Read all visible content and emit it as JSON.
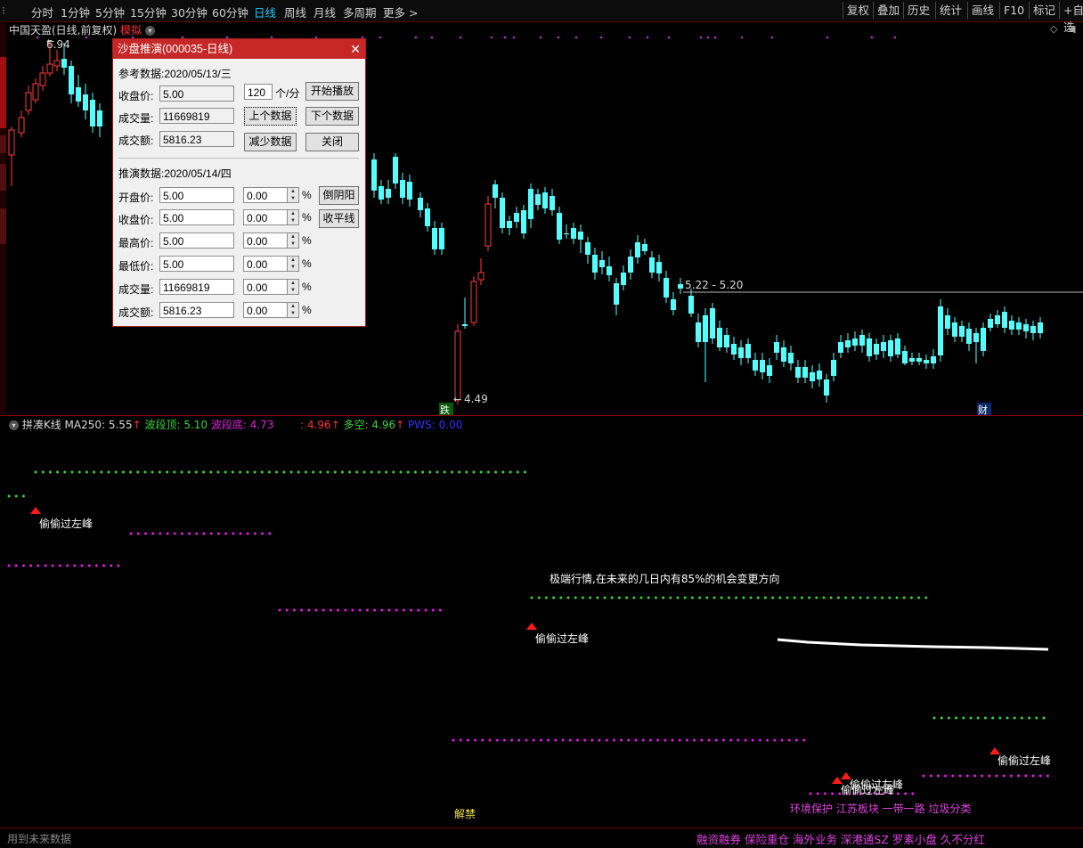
{
  "toolbar": {
    "periods": [
      "分时",
      "1分钟",
      "5分钟",
      "15分钟",
      "30分钟",
      "60分钟",
      "日线",
      "周线",
      "月线",
      "多周期",
      "更多 >"
    ],
    "active_index": 6,
    "right_buttons": [
      "复权",
      "叠加",
      "历史",
      "统计",
      "画线",
      "F10",
      "标记",
      "+自选"
    ]
  },
  "stock": {
    "title": "中国天盈(日线,前复权)",
    "mode": "模拟"
  },
  "main_chart": {
    "high_label": "6.94",
    "low_label": "4.49",
    "range_label": "5.22 - 5.20",
    "badge_left": "跌",
    "badge_right": "财"
  },
  "dialog": {
    "title": "沙盘推演(000035-日线)",
    "ref_date": "参考数据:2020/05/13/三",
    "close_label": "收盘价:",
    "close_value": "5.00",
    "vol_label": "成交量:",
    "vol_value": "11669819",
    "amt_label": "成交额:",
    "amt_value": "5816.23",
    "speed_value": "120",
    "speed_unit": "个/分",
    "play_button": "开始播放",
    "prev_button": "上个数据",
    "next_button": "下个数据",
    "reduce_button": "减少数据",
    "close_button": "关闭",
    "pred_date": "推演数据:2020/05/14/四",
    "rows": [
      {
        "label": "开盘价:",
        "value": "5.00",
        "pct": "0.00"
      },
      {
        "label": "收盘价:",
        "value": "5.00",
        "pct": "0.00"
      },
      {
        "label": "最高价:",
        "value": "5.00",
        "pct": "0.00"
      },
      {
        "label": "最低价:",
        "value": "5.00",
        "pct": "0.00"
      },
      {
        "label": "成交量:",
        "value": "11669819",
        "pct": "0.00"
      },
      {
        "label": "成交额:",
        "value": "5816.23",
        "pct": "0.00"
      }
    ],
    "pct_unit": "%",
    "invert_button": "倒阴阳",
    "flat_button": "收平线"
  },
  "indicator": {
    "name": "拼凑K线",
    "ma250": "MA250: 5.55",
    "top": "波段顶: 5.10",
    "bottom": "波段底: 4.73",
    "v4": ": 4.96",
    "duokong": "多空: 4.96",
    "pws": "PWS: 0.00",
    "annotations": [
      "偷偷过左峰",
      "偷偷过左峰",
      "偷偷过左峰",
      "偷偷过左峰",
      "偷偷过左峰"
    ],
    "extreme_text": "极端行情,在未来的几日内有85%的机会变更方向",
    "unlock_text": "解禁",
    "concepts": "环境保护 江苏板块 一带一路 垃圾分类"
  },
  "status": {
    "left": "用到未来数据",
    "tags": "融资融券 保险重仓 海外业务 深港通SZ 罗素小盘 久不分红"
  },
  "colors": {
    "up": "#ff3b3b",
    "down": "#54ffff",
    "green_dot": "#39d339",
    "magenta": "#e21ee2"
  }
}
